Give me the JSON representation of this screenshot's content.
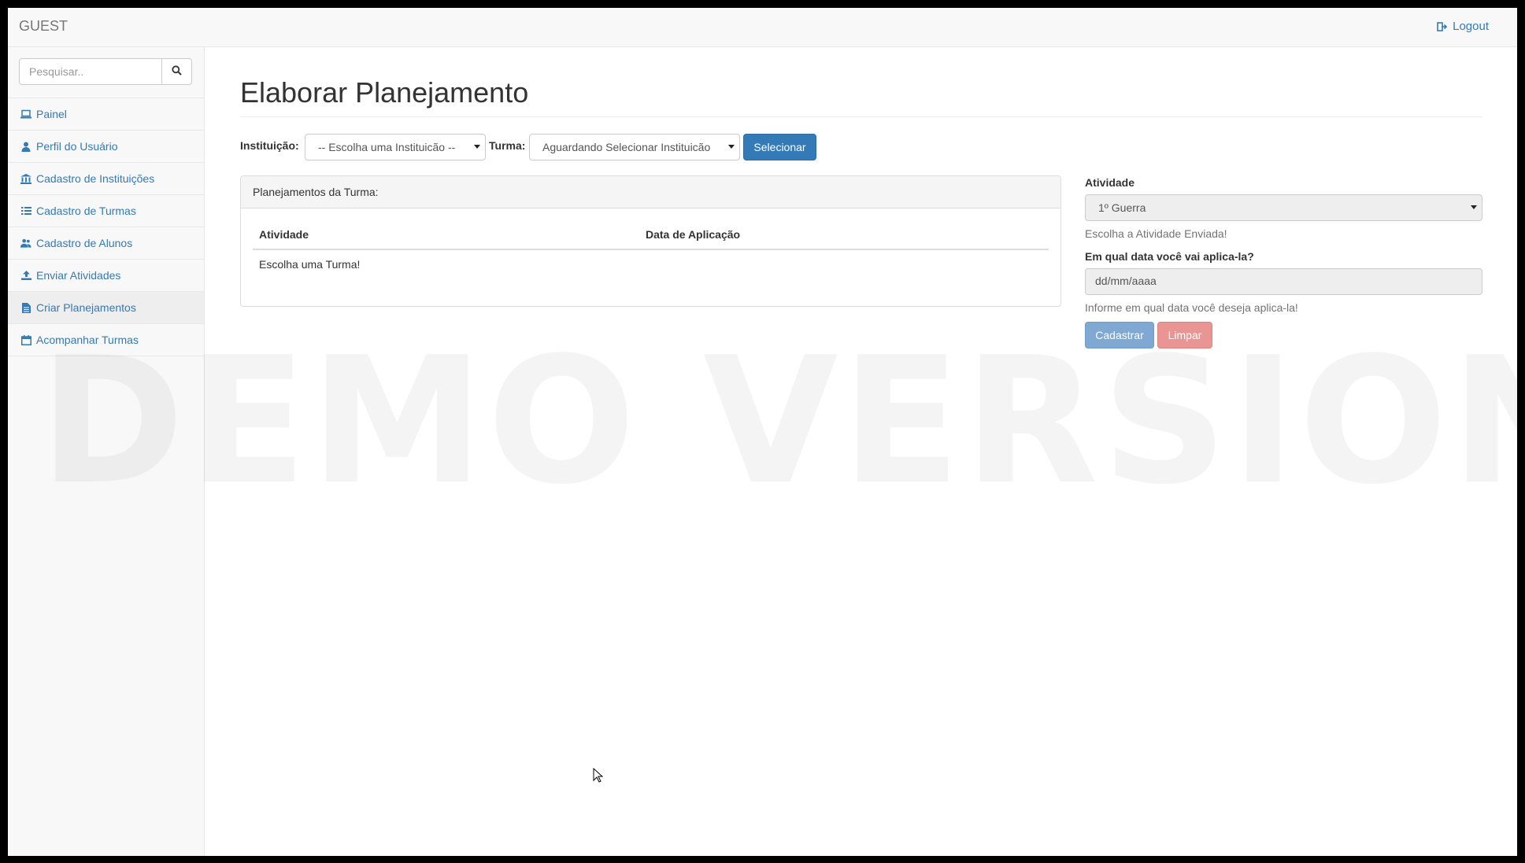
{
  "navbar": {
    "brand": "GUEST",
    "logout_label": "Logout"
  },
  "sidebar": {
    "search_placeholder": "Pesquisar..",
    "items": [
      {
        "label": "Painel",
        "icon": "laptop-icon"
      },
      {
        "label": "Perfil do Usuário",
        "icon": "user-icon"
      },
      {
        "label": "Cadastro de Instituições",
        "icon": "institution-icon"
      },
      {
        "label": "Cadastro de Turmas",
        "icon": "list-icon"
      },
      {
        "label": "Cadastro de Alunos",
        "icon": "users-icon"
      },
      {
        "label": "Enviar Atividades",
        "icon": "upload-icon"
      },
      {
        "label": "Criar Planejamentos",
        "icon": "file-icon",
        "active": true
      },
      {
        "label": "Acompanhar Turmas",
        "icon": "calendar-icon"
      }
    ]
  },
  "main": {
    "title": "Elaborar Planejamento",
    "filter": {
      "instituicao_label": "Instituição:",
      "instituicao_value": "-- Escolha uma Instituicão --",
      "turma_label": "Turma:",
      "turma_value": "Aguardando Selecionar Instituicão",
      "select_button": "Selecionar"
    },
    "panel": {
      "heading": "Planejamentos da Turma:",
      "columns": [
        "Atividade",
        "Data de Aplicação"
      ],
      "empty_message": "Escolha uma Turma!"
    },
    "form": {
      "atividade_label": "Atividade",
      "atividade_value": "1º Guerra",
      "atividade_help": "Escolha a Atividade Enviada!",
      "date_label": "Em qual data você vai aplica-la?",
      "date_placeholder": "dd/mm/aaaa",
      "date_help": "Informe em qual data você deseja aplica-la!",
      "submit_label": "Cadastrar",
      "clear_label": "Limpar"
    }
  },
  "watermark": "DEMO VERSION",
  "colors": {
    "link": "#337ab7",
    "primary": "#337ab7",
    "danger_disabled": "#e99593"
  }
}
